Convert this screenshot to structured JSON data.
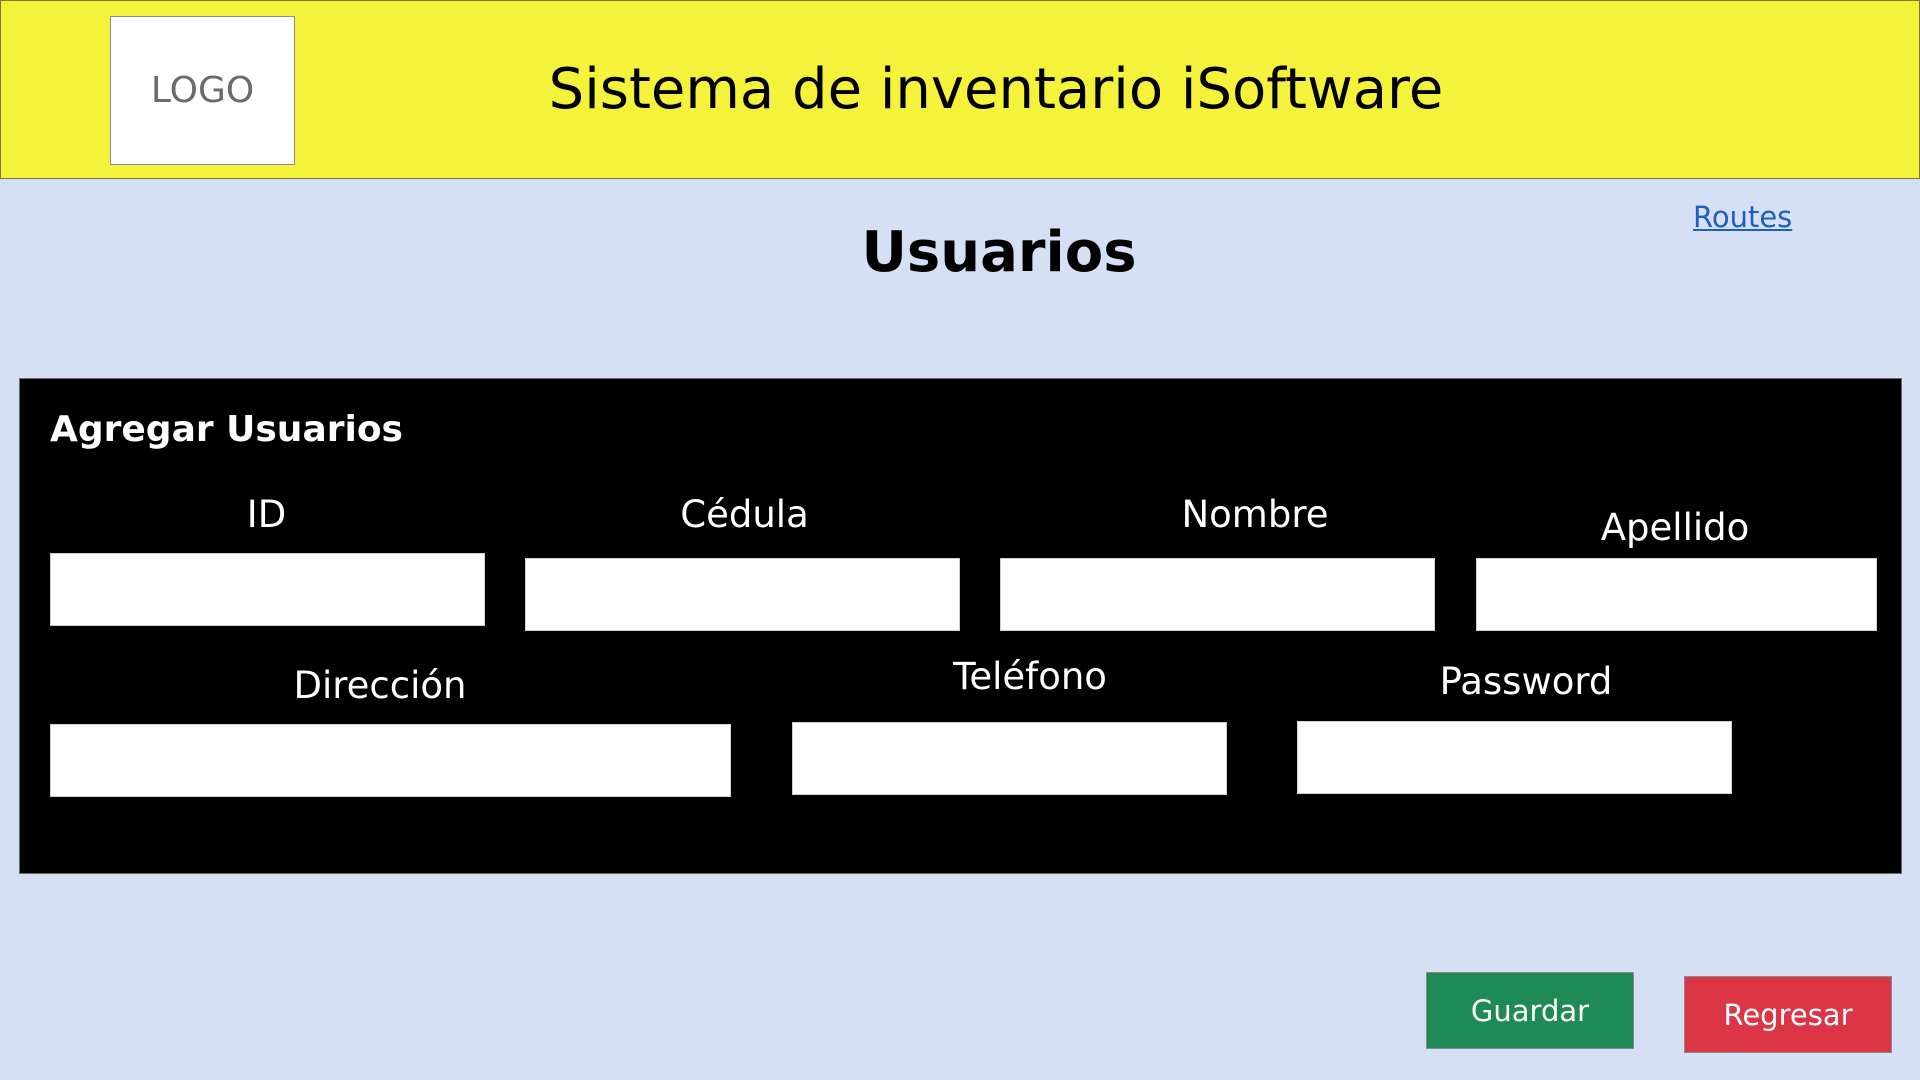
{
  "header": {
    "logo_text": "LOGO",
    "app_title": "Sistema de inventario iSoftware"
  },
  "nav": {
    "routes_label": "Routes"
  },
  "page": {
    "title": "Usuarios"
  },
  "form": {
    "title": "Agregar Usuarios",
    "fields": {
      "id": {
        "label": "ID",
        "value": ""
      },
      "cedula": {
        "label": "Cédula",
        "value": ""
      },
      "nombre": {
        "label": "Nombre",
        "value": ""
      },
      "apellido": {
        "label": "Apellido",
        "value": ""
      },
      "direccion": {
        "label": "Dirección",
        "value": ""
      },
      "telefono": {
        "label": "Teléfono",
        "value": ""
      },
      "password": {
        "label": "Password",
        "value": ""
      }
    }
  },
  "actions": {
    "save_label": "Guardar",
    "back_label": "Regresar"
  },
  "colors": {
    "header_bg": "#f5f23c",
    "page_bg": "#d6e0f5",
    "panel_bg": "#000000",
    "save_bg": "#1e8a55",
    "back_bg": "#dc3545",
    "link": "#1f5fbf"
  }
}
